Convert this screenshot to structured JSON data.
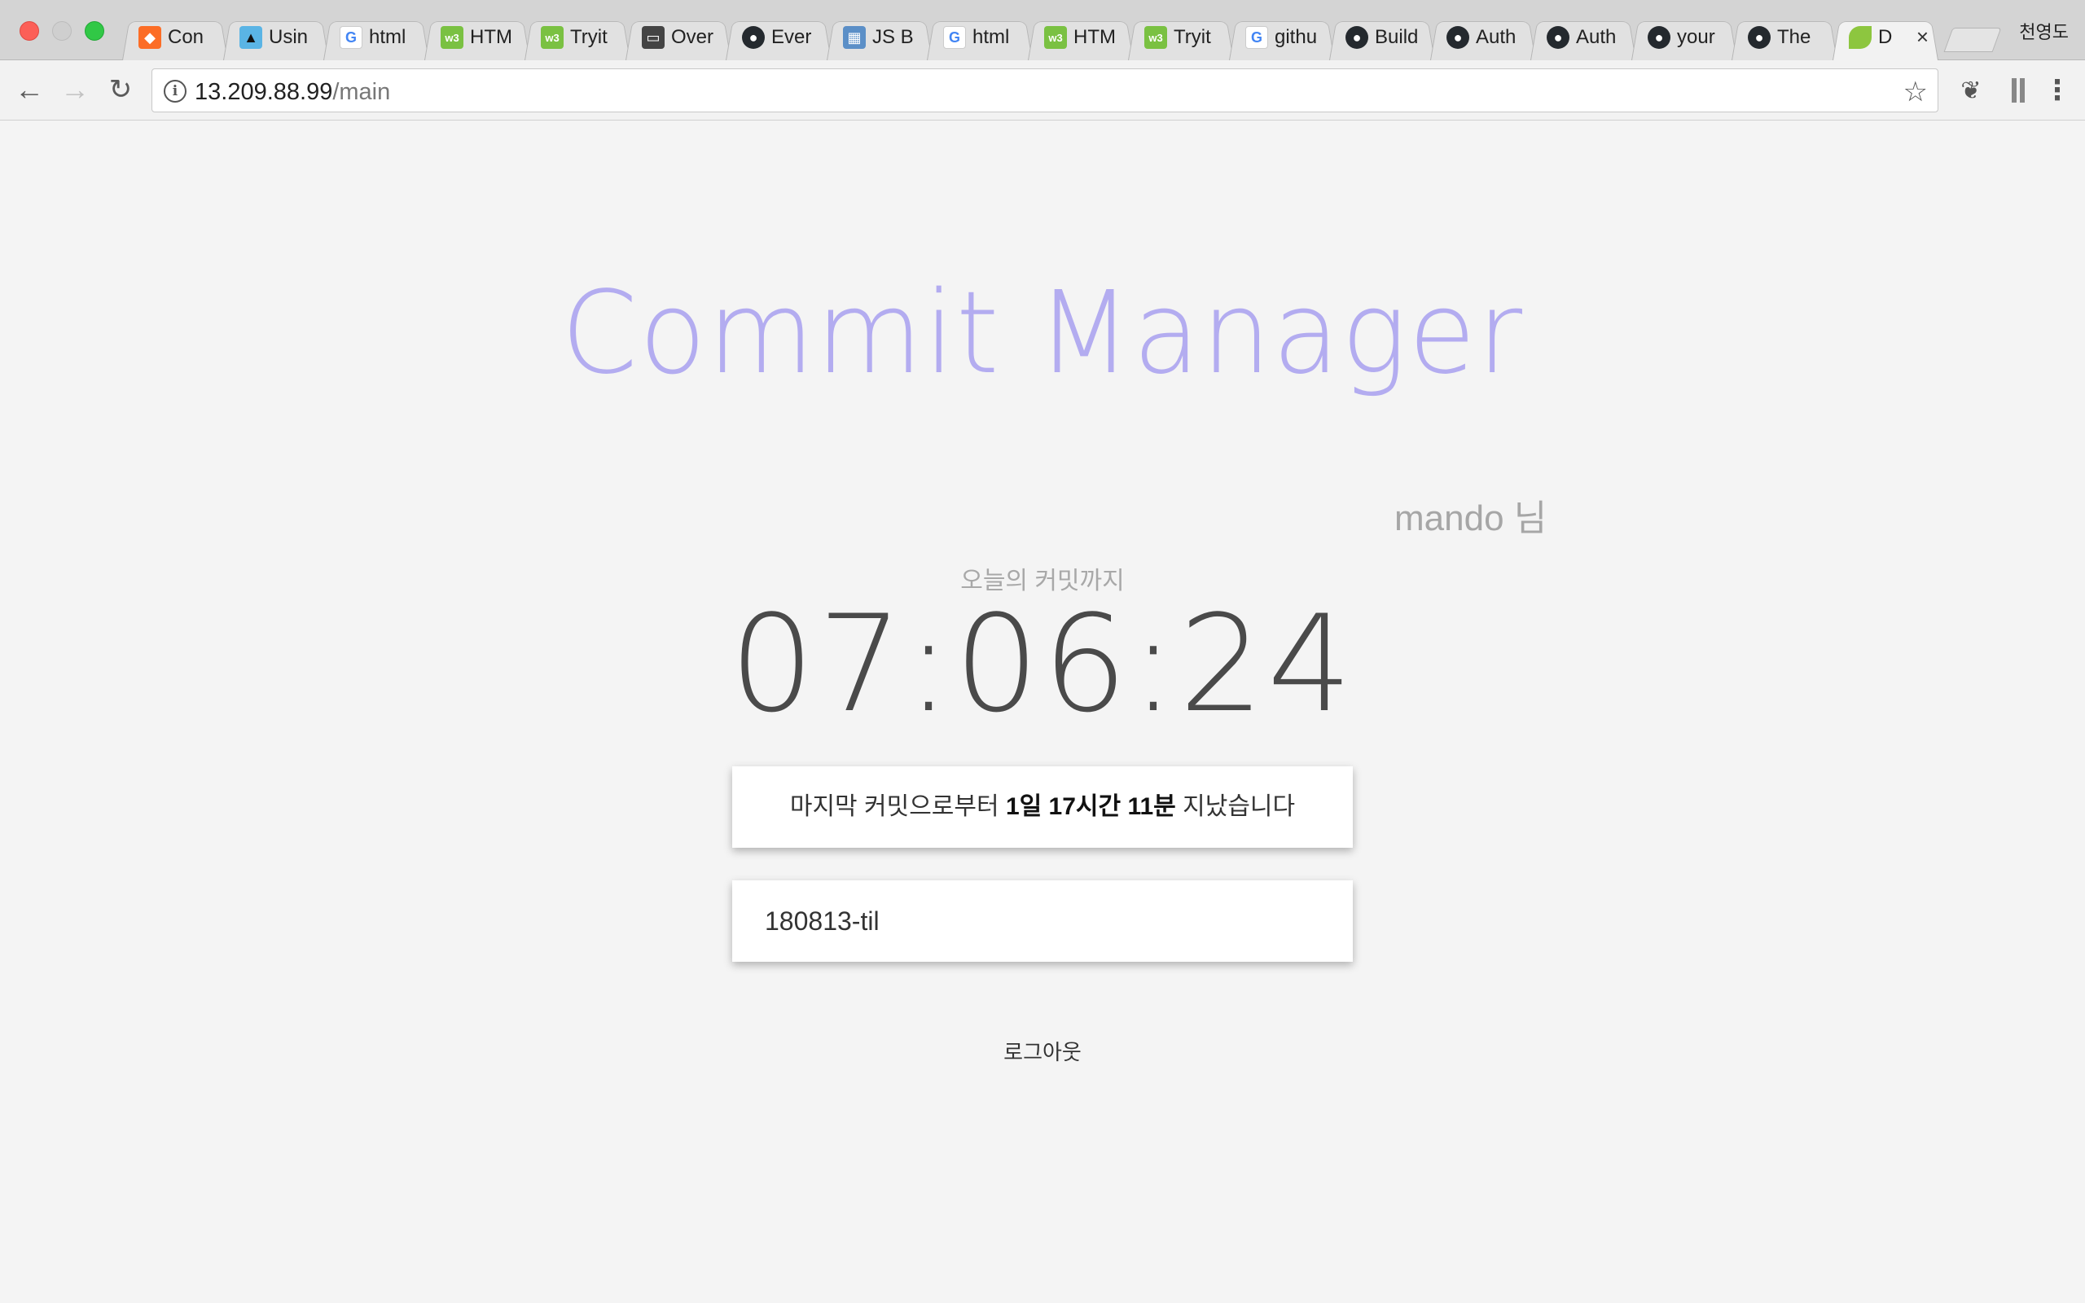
{
  "window": {
    "profile_name": "천영도"
  },
  "tabs": [
    {
      "label": "Con",
      "icon": "gitlab-icon",
      "glyph": "◆"
    },
    {
      "label": "Usin",
      "icon": "bird-icon",
      "glyph": "▲"
    },
    {
      "label": "html",
      "icon": "google-icon",
      "glyph": "G"
    },
    {
      "label": "HTM",
      "icon": "w3schools-icon",
      "glyph": "w3"
    },
    {
      "label": "Tryit",
      "icon": "w3schools-icon",
      "glyph": "w3"
    },
    {
      "label": "Over",
      "icon": "window-icon",
      "glyph": "▭"
    },
    {
      "label": "Ever",
      "icon": "github-icon",
      "glyph": "●"
    },
    {
      "label": "JS B",
      "icon": "js-icon",
      "glyph": "▦"
    },
    {
      "label": "html",
      "icon": "google-icon",
      "glyph": "G"
    },
    {
      "label": "HTM",
      "icon": "w3schools-icon",
      "glyph": "w3"
    },
    {
      "label": "Tryit",
      "icon": "w3schools-icon",
      "glyph": "w3"
    },
    {
      "label": "githu",
      "icon": "google-icon",
      "glyph": "G"
    },
    {
      "label": "Build",
      "icon": "github-icon",
      "glyph": "●"
    },
    {
      "label": "Auth",
      "icon": "github-icon",
      "glyph": "●"
    },
    {
      "label": "Auth",
      "icon": "github-icon",
      "glyph": "●"
    },
    {
      "label": "your",
      "icon": "github-icon",
      "glyph": "●"
    },
    {
      "label": "The",
      "icon": "github-icon",
      "glyph": "●"
    },
    {
      "label": "D",
      "icon": "leaf-icon",
      "glyph": "",
      "active": true,
      "close": "×"
    }
  ],
  "toolbar": {
    "back_glyph": "←",
    "forward_glyph": "→",
    "reload_glyph": "↻",
    "info_glyph": "i",
    "url_host": "13.209.88.99",
    "url_path": "/main",
    "star_glyph": "☆",
    "menu_glyph": "⋮",
    "evernote_glyph": "❦"
  },
  "page": {
    "title": "Commit Manager",
    "username": "mando 님",
    "countdown_label": "오늘의 커밋까지",
    "countdown": "07:06:24",
    "last_commit": {
      "prefix": "마지막 커밋으로부터 ",
      "elapsed": "1일 17시간 11분",
      "suffix": " 지났습니다"
    },
    "repo_input_value": "180813-til",
    "logout_label": "로그아웃"
  },
  "colors": {
    "title": "#b3acf0",
    "background": "#f4f4f4",
    "countdown": "#4a4a4a"
  }
}
